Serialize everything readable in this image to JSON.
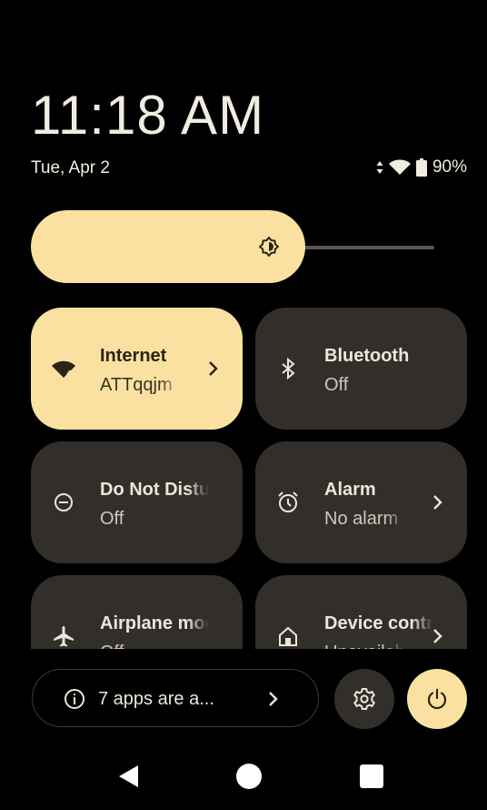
{
  "clock": {
    "time": "11:18 AM",
    "date": "Tue, Apr 2"
  },
  "status_bar": {
    "battery": "90%",
    "icons": [
      "data-arrows-icon",
      "wifi-icon",
      "battery-icon"
    ]
  },
  "brightness": {
    "level_fraction": 0.58,
    "icon": "brightness-icon"
  },
  "tiles": [
    {
      "id": "internet",
      "title": "Internet",
      "subtitle": "ATTqqjm",
      "active": true,
      "icon": "wifi-icon",
      "has_chevron": true
    },
    {
      "id": "bluetooth",
      "title": "Bluetooth",
      "subtitle": "Off",
      "active": false,
      "icon": "bluetooth-icon",
      "has_chevron": false
    },
    {
      "id": "dnd",
      "title": "Do Not Disturb",
      "subtitle": "Off",
      "active": false,
      "icon": "dnd-icon",
      "has_chevron": false
    },
    {
      "id": "alarm",
      "title": "Alarm",
      "subtitle": "No alarm",
      "active": false,
      "icon": "alarm-icon",
      "has_chevron": true
    },
    {
      "id": "airplane",
      "title": "Airplane mode",
      "subtitle": "Off",
      "active": false,
      "icon": "airplane-icon",
      "has_chevron": false
    },
    {
      "id": "device",
      "title": "Device controls",
      "subtitle": "Unavailable",
      "active": false,
      "icon": "home-icon",
      "has_chevron": true
    }
  ],
  "footer": {
    "apps_label": "7 apps are a...",
    "settings_icon": "gear-icon",
    "power_icon": "power-icon"
  },
  "nav_bar": {
    "icons": [
      "back-icon",
      "home-icon",
      "recents-icon"
    ]
  },
  "colors": {
    "accent": "#fbe1a1",
    "tile_bg": "#322f2b",
    "background": "#000000"
  }
}
